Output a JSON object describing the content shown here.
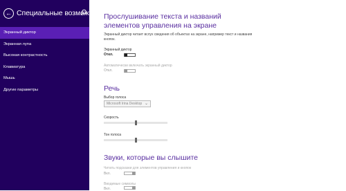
{
  "sidebar": {
    "title": "Специальные возможн...",
    "items": [
      {
        "label": "Экранный диктор"
      },
      {
        "label": "Экранная лупа"
      },
      {
        "label": "Высокая контрастность"
      },
      {
        "label": "Клавиатура"
      },
      {
        "label": "Мышь"
      },
      {
        "label": "Другие параметры"
      }
    ]
  },
  "main": {
    "heading": "Прослушивание текста и названий элементов управления на экране",
    "description": "Экранный диктор читает вслух сведения об объектах на экране, например текст и названия кнопок.",
    "faded_hint": "...",
    "narrator": {
      "label": "Экранный диктор",
      "state": "Откл."
    },
    "auto_start": {
      "label": "Автоматически включать экранный диктор",
      "state": "Откл."
    },
    "speech": {
      "heading": "Речь",
      "voice_label": "Выбор голоса",
      "voice_value": "Microsoft Irina Desktop",
      "speed_label": "Скорость",
      "speed_value": 0.5,
      "pitch_label": "Тон голоса",
      "pitch_value": 0.5
    },
    "sounds": {
      "heading": "Звуки, которые вы слышите",
      "hints_label": "Читать подсказки для элементов управления и кнопок",
      "hints_state": "Вкл.",
      "typed_label": "Вводимые символы",
      "typed_state": "Вкл."
    }
  },
  "colors": {
    "sidebar_bg": "#21005e",
    "selected_bg": "#5a1fb5",
    "accent": "#5a2fa0"
  }
}
